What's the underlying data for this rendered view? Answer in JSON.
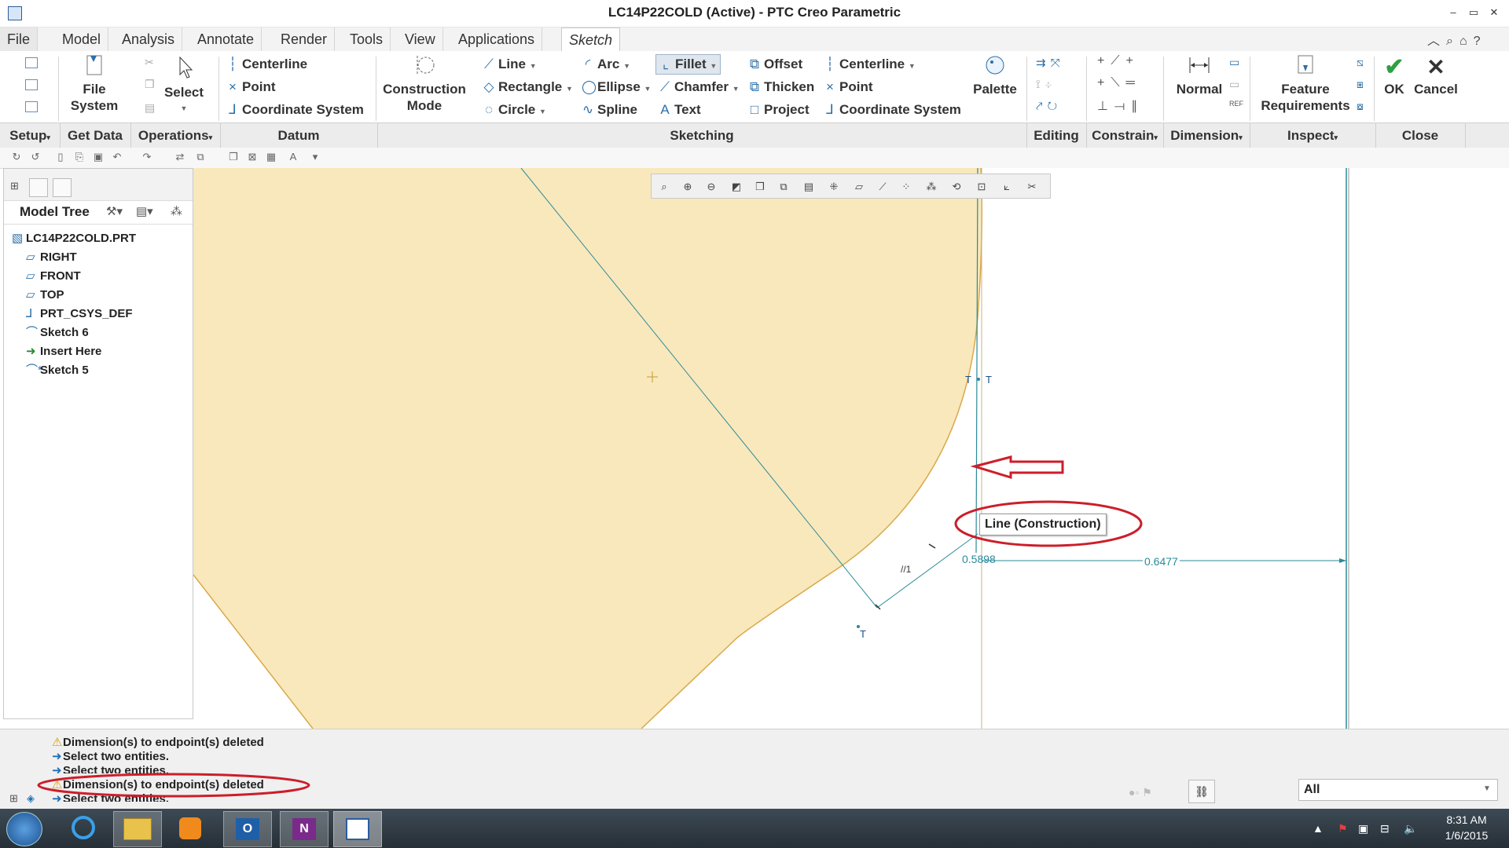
{
  "window": {
    "title": "LC14P22COLD (Active) - PTC Creo Parametric",
    "controls": [
      "–",
      "▭",
      "✕"
    ],
    "help_icons": [
      "︿",
      "⌕",
      "⌂",
      "?"
    ]
  },
  "menu": {
    "tabs": [
      "File",
      "Model",
      "Analysis",
      "Annotate",
      "Render",
      "Tools",
      "View",
      "Applications",
      "Sketch"
    ]
  },
  "ribbon": {
    "file_system": [
      "File",
      "System"
    ],
    "select": "Select",
    "datum": {
      "centerline": "Centerline",
      "point": "Point",
      "coordinate_system": "Coordinate System"
    },
    "construction_mode": [
      "Construction",
      "Mode"
    ],
    "sketching": {
      "line": "Line",
      "rectangle": "Rectangle",
      "circle": "Circle",
      "arc": "Arc",
      "ellipse": "Ellipse",
      "spline": "Spline",
      "fillet": "Fillet",
      "chamfer": "Chamfer",
      "text": "Text",
      "offset": "Offset",
      "thicken": "Thicken",
      "project": "Project",
      "centerline": "Centerline",
      "point": "Point",
      "coordinate_system": "Coordinate System",
      "palette": "Palette"
    },
    "normal": "Normal",
    "feature_requirements": [
      "Feature",
      "Requirements"
    ],
    "ok": "OK",
    "cancel": "Cancel",
    "groups": [
      "Setup",
      "Get Data",
      "Operations",
      "Datum",
      "Sketching",
      "Editing",
      "Constrain",
      "Dimension",
      "Inspect",
      "Close"
    ]
  },
  "model_tree": {
    "title": "Model Tree",
    "items": [
      {
        "label": "LC14P22COLD.PRT",
        "icon": "part-icon"
      },
      {
        "label": "RIGHT",
        "icon": "datum-plane-icon"
      },
      {
        "label": "FRONT",
        "icon": "datum-plane-icon"
      },
      {
        "label": "TOP",
        "icon": "datum-plane-icon"
      },
      {
        "label": "PRT_CSYS_DEF",
        "icon": "csys-icon"
      },
      {
        "label": "Sketch 6",
        "icon": "sketch-icon"
      },
      {
        "label": "Insert Here",
        "icon": "insert-arrow-icon"
      },
      {
        "label": "Sketch 5",
        "icon": "sketch-icon"
      }
    ]
  },
  "sketch": {
    "tooltip": "Line (Construction)",
    "dim1": "0.5898",
    "dim2": "0.6477",
    "constraint_t": "T",
    "constraint_parallel": "//1",
    "colors": {
      "fill": "#f8e8bb",
      "edge": "#d9a84a",
      "construction": "#2a8a9a",
      "annotation_red": "#cc1e2a"
    }
  },
  "messages": [
    {
      "icon": "warning-icon",
      "text": "Dimension(s) to endpoint(s) deleted"
    },
    {
      "icon": "arrow-icon",
      "text": "Select two entities."
    },
    {
      "icon": "arrow-icon",
      "text": "Select two entities."
    },
    {
      "icon": "warning-icon",
      "text": "Dimension(s) to endpoint(s) deleted"
    },
    {
      "icon": "arrow-icon",
      "text": "Select two entities."
    }
  ],
  "filter": {
    "value": "All"
  },
  "taskbar": {
    "time": "8:31 AM",
    "date": "1/6/2015"
  }
}
